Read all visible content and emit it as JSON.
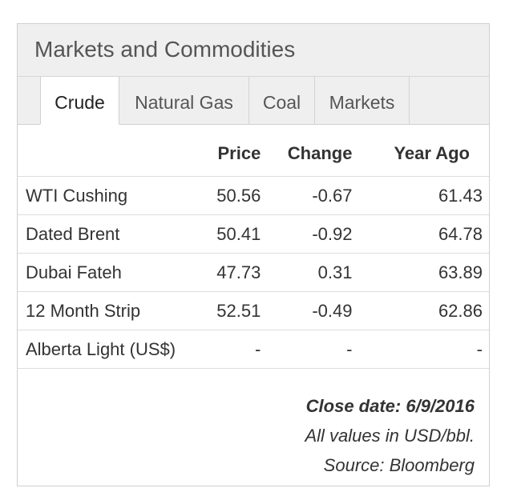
{
  "widget": {
    "title": "Markets and Commodities",
    "tabs": [
      {
        "label": "Crude",
        "active": true
      },
      {
        "label": "Natural Gas",
        "active": false
      },
      {
        "label": "Coal",
        "active": false
      },
      {
        "label": "Markets",
        "active": false
      }
    ],
    "table": {
      "headers": [
        "",
        "Price",
        "Change",
        "Year Ago"
      ],
      "rows": [
        {
          "name": "WTI Cushing",
          "price": "50.56",
          "change": "-0.67",
          "year_ago": "61.43"
        },
        {
          "name": "Dated Brent",
          "price": "50.41",
          "change": "-0.92",
          "year_ago": "64.78"
        },
        {
          "name": "Dubai Fateh",
          "price": "47.73",
          "change": "0.31",
          "year_ago": "63.89"
        },
        {
          "name": "12 Month Strip",
          "price": "52.51",
          "change": "-0.49",
          "year_ago": "62.86"
        },
        {
          "name": "Alberta Light (US$)",
          "price": "-",
          "change": "-",
          "year_ago": "-"
        }
      ]
    },
    "footer": {
      "close_date": "Close date: 6/9/2016",
      "units": "All values in USD/bbl.",
      "source": "Source: Bloomberg"
    }
  }
}
